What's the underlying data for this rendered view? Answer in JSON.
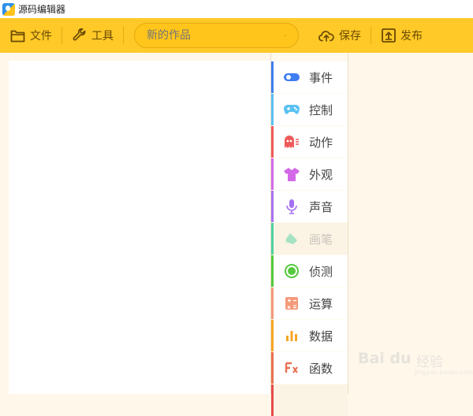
{
  "window": {
    "title": "源码编辑器"
  },
  "toolbar": {
    "file_label": "文件",
    "tools_label": "工具",
    "project_name_placeholder": "新的作品",
    "save_label": "保存",
    "publish_label": "发布"
  },
  "categories": [
    {
      "label": "事件",
      "color": "#3f7df0",
      "icon": "toggle-icon",
      "disabled": false
    },
    {
      "label": "控制",
      "color": "#5ac2f2",
      "icon": "gamepad-icon",
      "disabled": false
    },
    {
      "label": "动作",
      "color": "#ef5a5a",
      "icon": "ghost-icon",
      "disabled": false
    },
    {
      "label": "外观",
      "color": "#d469e8",
      "icon": "shirt-icon",
      "disabled": false
    },
    {
      "label": "声音",
      "color": "#a772f0",
      "icon": "microphone-icon",
      "disabled": false
    },
    {
      "label": "画笔",
      "color": "#4fd1a1",
      "icon": "brush-icon",
      "disabled": true
    },
    {
      "label": "侦测",
      "color": "#54c93c",
      "icon": "radar-icon",
      "disabled": false
    },
    {
      "label": "运算",
      "color": "#f49a7a",
      "icon": "calculator-icon",
      "disabled": false
    },
    {
      "label": "数据",
      "color": "#f5a623",
      "icon": "bar-chart-icon",
      "disabled": false
    },
    {
      "label": "函数",
      "color": "#e8704f",
      "icon": "function-icon",
      "disabled": false
    }
  ],
  "watermark": {
    "logo": "Bai du",
    "text": "经验",
    "sub": "jingyan.baidu.com"
  }
}
